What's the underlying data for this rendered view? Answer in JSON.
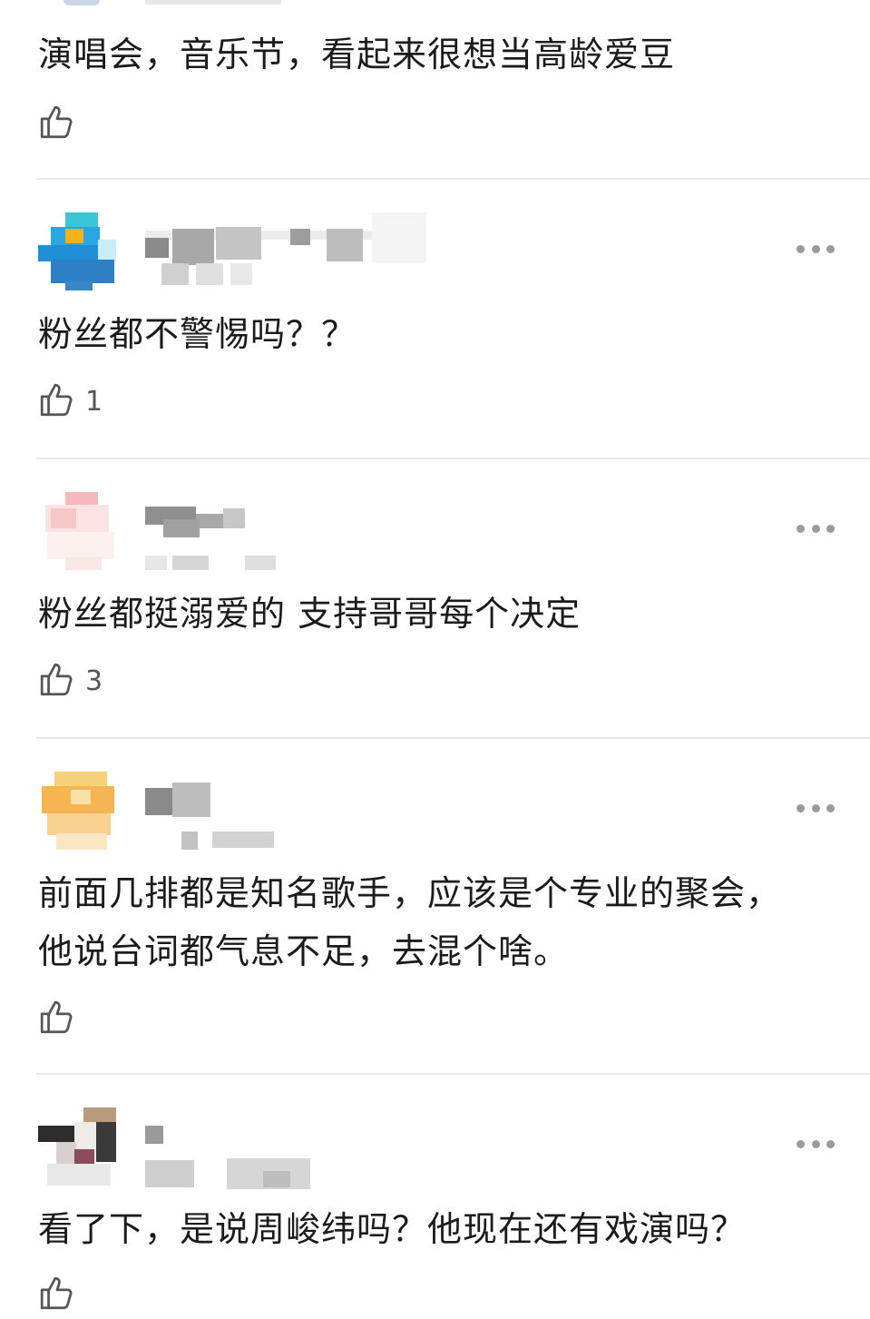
{
  "comments": [
    {
      "text": "演唱会，音乐节，看起来很想当高龄爱豆",
      "like_icon": "thumbs-up-icon",
      "likes": ""
    },
    {
      "text": "粉丝都不警惕吗？？",
      "like_icon": "thumbs-up-icon",
      "likes": "1",
      "more_icon": "more-dots-icon"
    },
    {
      "text": "粉丝都挺溺爱的 支持哥哥每个决定",
      "like_icon": "thumbs-up-icon",
      "likes": "3",
      "more_icon": "more-dots-icon"
    },
    {
      "text": "前面几排都是知名歌手，应该是个专业的聚会，\n他说台词都气息不足，去混个啥。",
      "like_icon": "thumbs-up-icon",
      "likes": "",
      "more_icon": "more-dots-icon"
    },
    {
      "text": "看了下，是说周峻纬吗？他现在还有戏演吗？",
      "like_icon": "thumbs-up-icon",
      "likes": "",
      "more_icon": "more-dots-icon"
    }
  ],
  "colors": {
    "divider": "#e9e9e9",
    "text": "#1b1b1b",
    "icon": "#555555"
  }
}
